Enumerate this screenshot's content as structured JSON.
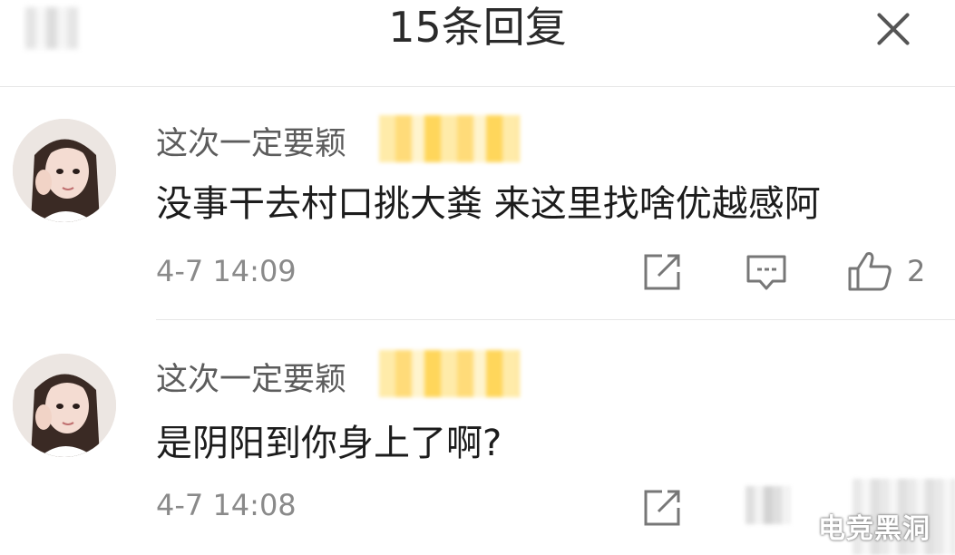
{
  "header": {
    "title": "15条回复"
  },
  "comments": [
    {
      "name": "这次一定要颖",
      "text": "没事干去村口挑大粪 来这里找啥优越感阿",
      "time": "4-7 14:09",
      "likes": "2"
    },
    {
      "name": "这次一定要颖",
      "text": "是阴阳到你身上了啊?",
      "time": "4-7 14:08"
    }
  ],
  "watermark": "电竞黑洞",
  "colors": {
    "text": "#1c1c1c",
    "muted": "#8a8a8a",
    "badge": "#ffd86b",
    "icon": "#777777"
  }
}
